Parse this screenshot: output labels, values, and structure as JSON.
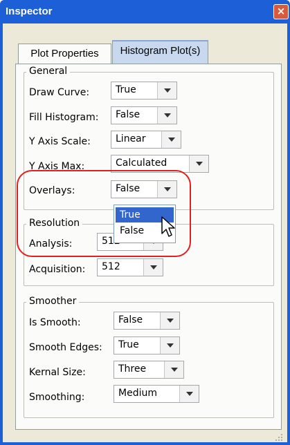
{
  "window": {
    "title": "Inspector",
    "close_glyph": "×"
  },
  "tabs": [
    {
      "label": "Plot Properties"
    },
    {
      "label": "Histogram Plot(s)"
    }
  ],
  "general": {
    "title": "General",
    "rows": [
      {
        "label": "Draw Curve:",
        "value": "True"
      },
      {
        "label": "Fill Histogram:",
        "value": "False"
      },
      {
        "label": "Y Axis Scale:",
        "value": "Linear"
      },
      {
        "label": "Y Axis Max:",
        "value": "Calculated"
      },
      {
        "label": "Overlays:",
        "value": "False"
      }
    ]
  },
  "overlays_dropdown": {
    "options": [
      "True",
      "False"
    ],
    "selected": "True"
  },
  "resolution": {
    "title": "Resolution",
    "rows": [
      {
        "label": "Analysis:",
        "value": "512"
      },
      {
        "label": "Acquisition:",
        "value": "512"
      }
    ]
  },
  "smoother": {
    "title": "Smoother",
    "rows": [
      {
        "label": "Is Smooth:",
        "value": "False"
      },
      {
        "label": "Smooth Edges:",
        "value": "True"
      },
      {
        "label": "Kernal Size:",
        "value": "Three"
      },
      {
        "label": "Smoothing:",
        "value": "Medium"
      }
    ]
  },
  "colors": {
    "titlebar": "#1d5fd6",
    "selection": "#3366cc",
    "annotation": "#e02020"
  },
  "icons": {
    "close": "close-icon",
    "dropdown": "chevron-down-icon",
    "cursor": "mouse-pointer-icon",
    "grip": "resize-grip-icon"
  }
}
